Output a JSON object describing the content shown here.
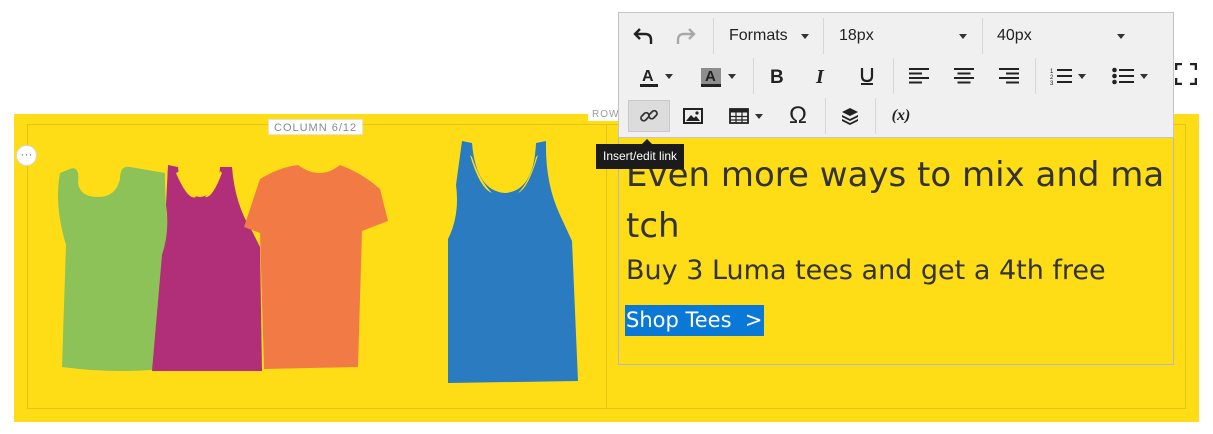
{
  "layout": {
    "row_label": "ROW",
    "column_label": "COLUMN 6/12",
    "options_icon": "ellipsis-icon"
  },
  "colors": {
    "row_background": "#fedd17",
    "link_background": "#0a78d7",
    "tee_green": "#8cc257",
    "tee_magenta": "#b02f78",
    "tee_orange": "#f27b45",
    "tee_blue": "#2a7bbf"
  },
  "toolbar": {
    "undo_icon": "undo-icon",
    "redo_icon": "redo-icon",
    "formats_label": "Formats",
    "font_size": "18px",
    "line_height": "40px",
    "text_color_icon": "text-color-icon",
    "background_color_icon": "background-color-icon",
    "bold_icon": "bold-icon",
    "italic_icon": "italic-icon",
    "underline_icon": "underline-icon",
    "align_left_icon": "align-left-icon",
    "align_center_icon": "align-center-icon",
    "align_right_icon": "align-right-icon",
    "numbered_list_icon": "numbered-list-icon",
    "bullet_list_icon": "bullet-list-icon",
    "link_icon": "link-icon",
    "image_icon": "image-icon",
    "table_icon": "table-icon",
    "special_char": "Ω",
    "widget_icon": "widget-icon",
    "variable_label": "(x)",
    "fullscreen_icon": "fullscreen-icon"
  },
  "tooltip": "Insert/edit link",
  "content": {
    "headline": "Even more ways to mix and match",
    "subheadline": "Buy 3 Luma tees and get a 4th free",
    "link_text": "Shop Tees  >"
  }
}
